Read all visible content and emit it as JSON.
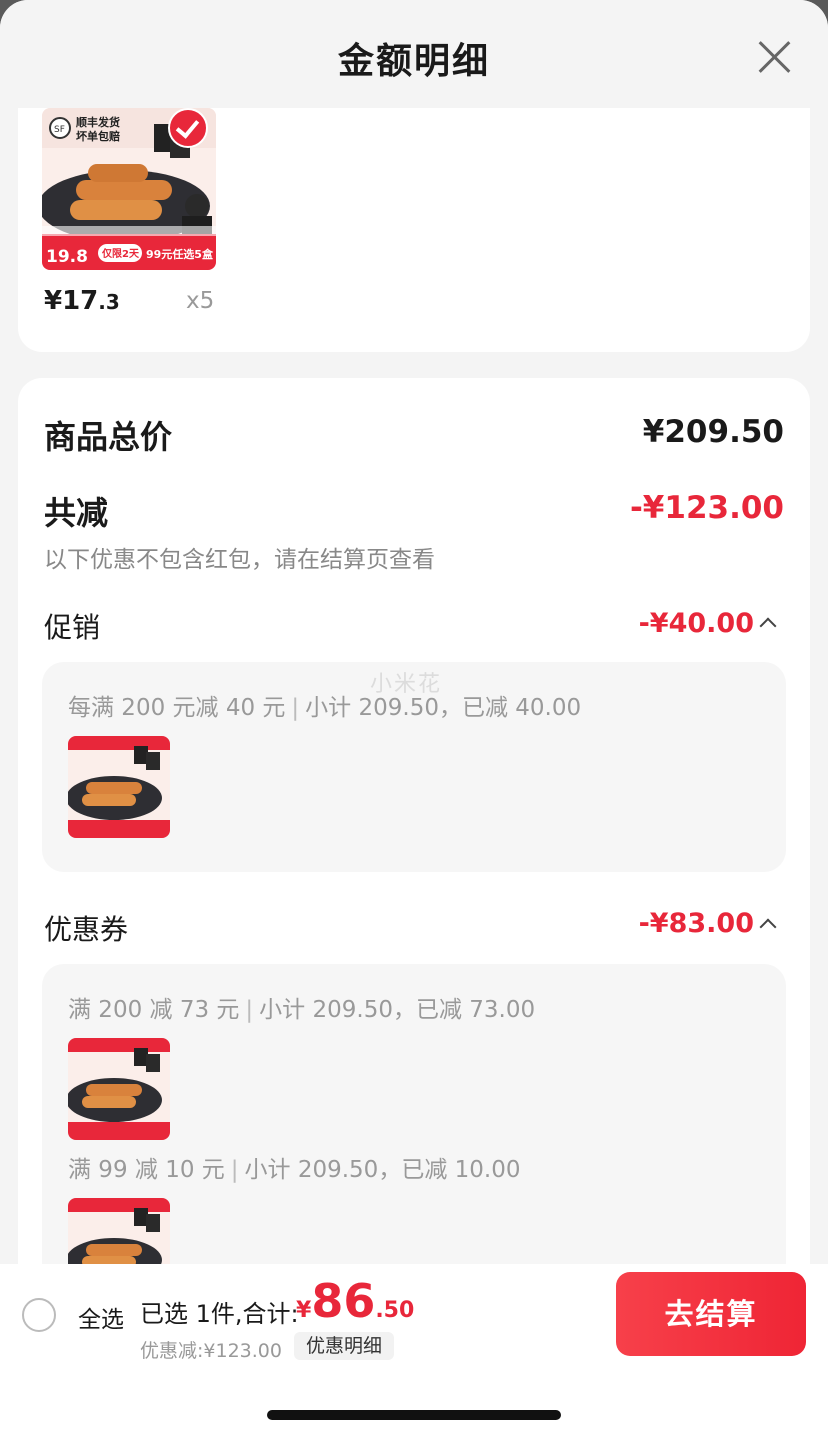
{
  "header": {
    "title": "金额明细"
  },
  "product": {
    "price_int": "¥17",
    "price_dec": ".3",
    "qty": "x5",
    "image_text": {
      "sf": "SF",
      "tag1": "顺丰发货",
      "tag2": "坏单包赔",
      "big_price": "19.8",
      "limit": "仅限2天",
      "offer": "99元任选5盒"
    }
  },
  "summary": {
    "total_label": "商品总价",
    "total_value": "¥209.50",
    "reduce_label": "共减",
    "reduce_value": "-¥123.00",
    "note": "以下优惠不包含红包，请在结算页查看"
  },
  "promotion": {
    "label": "促销",
    "value": "-¥40.00",
    "rule": "每满 200 元减 40 元",
    "subtotal": "小计 209.50，已减 40.00"
  },
  "coupon": {
    "label": "优惠券",
    "value": "-¥83.00",
    "rules": [
      {
        "rule": "满 200 减 73 元",
        "subtotal": "小计 209.50，已减 73.00"
      },
      {
        "rule": "满 99 减 10 元",
        "subtotal": "小计 209.50，已减 10.00"
      }
    ]
  },
  "watermark": "小米花",
  "bottom": {
    "select_all": "全选",
    "selected_text": "已选 1件,合计:",
    "yen": "¥",
    "total_int": "86",
    "total_dec": ".50",
    "discount": "优惠减:¥123.00",
    "detail_chip": "优惠明细",
    "checkout": "去结算"
  },
  "colors": {
    "accent": "#e8273a",
    "button": "#f23a45"
  }
}
